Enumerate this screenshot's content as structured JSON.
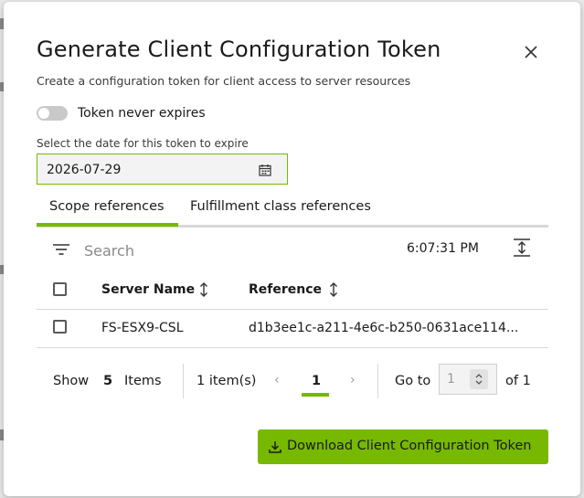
{
  "dialog": {
    "title": "Generate Client Configuration Token",
    "subtitle": "Create a configuration token for client access to server resources",
    "close_icon": "close-icon"
  },
  "expiry": {
    "toggle_label": "Token never expires",
    "toggle_on": false,
    "date_label": "Select the date for this token to expire",
    "date_value": "2026-07-29",
    "calendar_icon": "calendar-icon"
  },
  "tabs": [
    {
      "label": "Scope references",
      "active": true
    },
    {
      "label": "Fulfillment class references",
      "active": false
    }
  ],
  "toolbar": {
    "search_placeholder": "Search",
    "time": "6:07:31 PM",
    "filter_icon": "filter-icon",
    "density_icon": "row-density-icon"
  },
  "table": {
    "columns": [
      "Server Name",
      "Reference"
    ],
    "rows": [
      {
        "server_name": "FS-ESX9-CSL",
        "reference": "d1b3ee1c-a211-4e6c-b250-0631ace114..."
      }
    ]
  },
  "pagination": {
    "show_label": "Show",
    "page_size": "5",
    "items_label": "Items",
    "count": "1 item(s)",
    "current_page": "1",
    "goto_label": "Go to",
    "goto_value": "1",
    "of_label": "of 1"
  },
  "actions": {
    "download_label": "Download Client Configuration Token",
    "download_icon": "download-icon"
  },
  "colors": {
    "accent": "#76b900",
    "border": "#d9d9d9"
  }
}
